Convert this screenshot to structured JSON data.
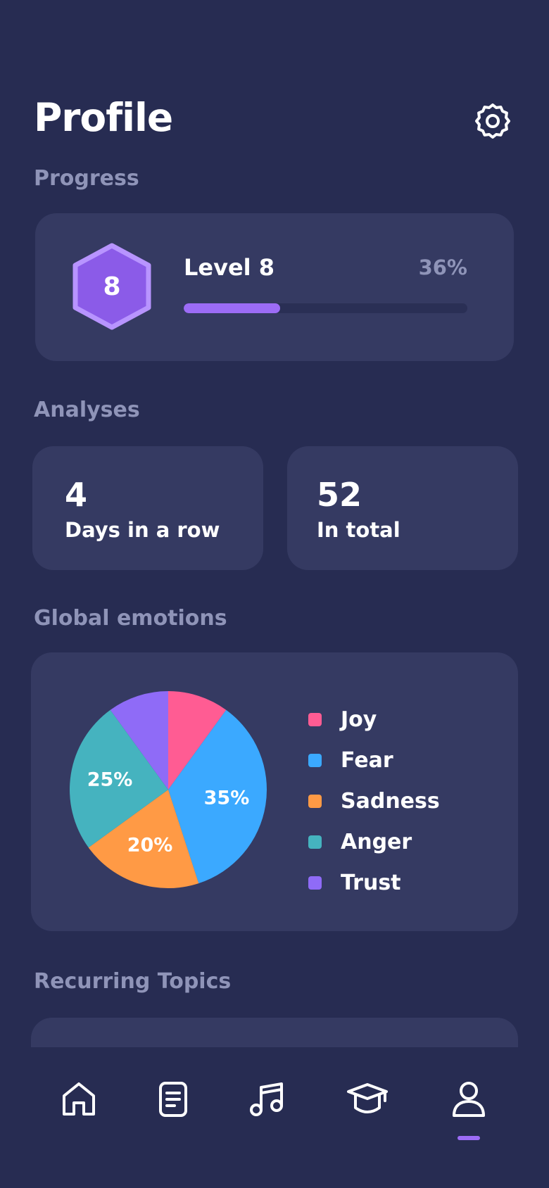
{
  "header": {
    "title": "Profile",
    "settings_icon": "gear-icon"
  },
  "progress": {
    "section_label": "Progress",
    "level_number": "8",
    "level_label": "Level 8",
    "percent_label": "36%",
    "fraction": 0.34
  },
  "analyses": {
    "section_label": "Analyses",
    "cards": [
      {
        "value": "4",
        "label": "Days in a row"
      },
      {
        "value": "52",
        "label": "In total"
      }
    ]
  },
  "emotions": {
    "section_label": "Global emotions",
    "chart_data": {
      "type": "pie",
      "slices": [
        {
          "label": "Joy",
          "value": 10,
          "color": "#FF5C93",
          "show_label": false
        },
        {
          "label": "Fear",
          "value": 35,
          "color": "#3BA9FF",
          "show_label": true
        },
        {
          "label": "Sadness",
          "value": 20,
          "color": "#FF9A45",
          "show_label": true
        },
        {
          "label": "Anger",
          "value": 25,
          "color": "#45B3BF",
          "show_label": true
        },
        {
          "label": "Trust",
          "value": 10,
          "color": "#8F6BF7",
          "show_label": false
        }
      ],
      "data_labels": [
        "35%",
        "20%",
        "25%"
      ]
    },
    "legend": [
      "Joy",
      "Fear",
      "Sadness",
      "Anger",
      "Trust"
    ]
  },
  "recurring": {
    "section_label": "Recurring Topics"
  },
  "nav": {
    "items": [
      {
        "icon": "home-icon"
      },
      {
        "icon": "journal-icon"
      },
      {
        "icon": "music-icon"
      },
      {
        "icon": "graduation-cap-icon"
      },
      {
        "icon": "profile-icon",
        "active": true
      }
    ]
  },
  "colors": {
    "background": "#272C52",
    "card": "#353A62",
    "accent": "#9C6CF6",
    "muted_text": "#8F94B8"
  }
}
